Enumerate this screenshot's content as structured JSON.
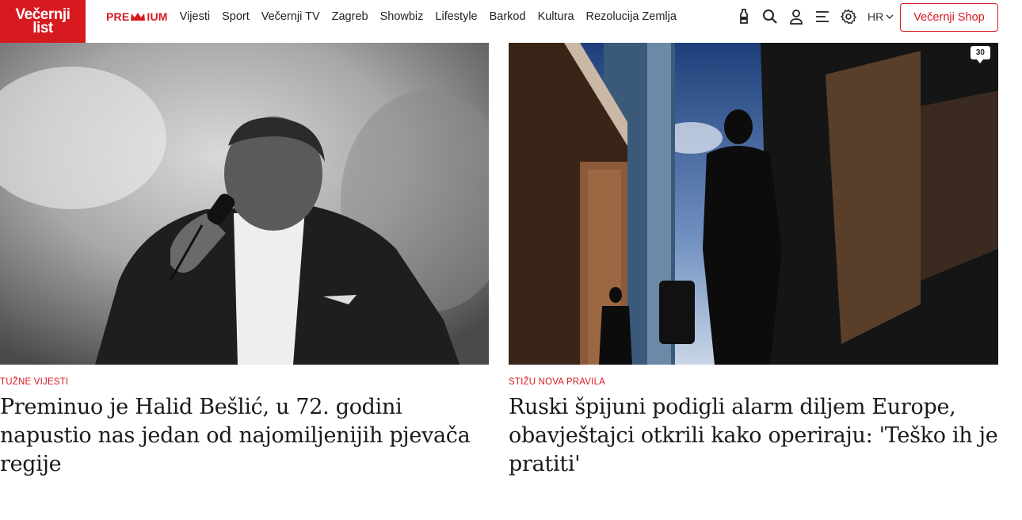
{
  "header": {
    "logo_line1": "Večernji",
    "logo_line2": "list",
    "premium": {
      "prefix": "PRE",
      "suffix": "IUM"
    },
    "nav": [
      "Vijesti",
      "Sport",
      "Večernji TV",
      "Zagreb",
      "Showbiz",
      "Lifestyle",
      "Barkod",
      "Kultura",
      "Rezolucija Zemlja"
    ],
    "icons": [
      "bottle-icon",
      "search-icon",
      "user-icon",
      "menu-icon",
      "settings-icon"
    ],
    "language": "HR",
    "shop_button": "Večernji Shop"
  },
  "articles": [
    {
      "kicker": "TUŽNE VIJESTI",
      "title": "Preminuo je Halid Bešlić, u 72. godini napustio nas jedan od najomiljenijih pjevača regije"
    },
    {
      "kicker": "STIŽU NOVA PRAVILA",
      "title": "Ruski špijuni podigli alarm diljem Europe, obavještajci otkrili kako operiraju: 'Teško ih je pratiti'",
      "comment_count": "30"
    }
  ],
  "colors": {
    "brand": "#d71920",
    "text": "#1a1a1a"
  }
}
